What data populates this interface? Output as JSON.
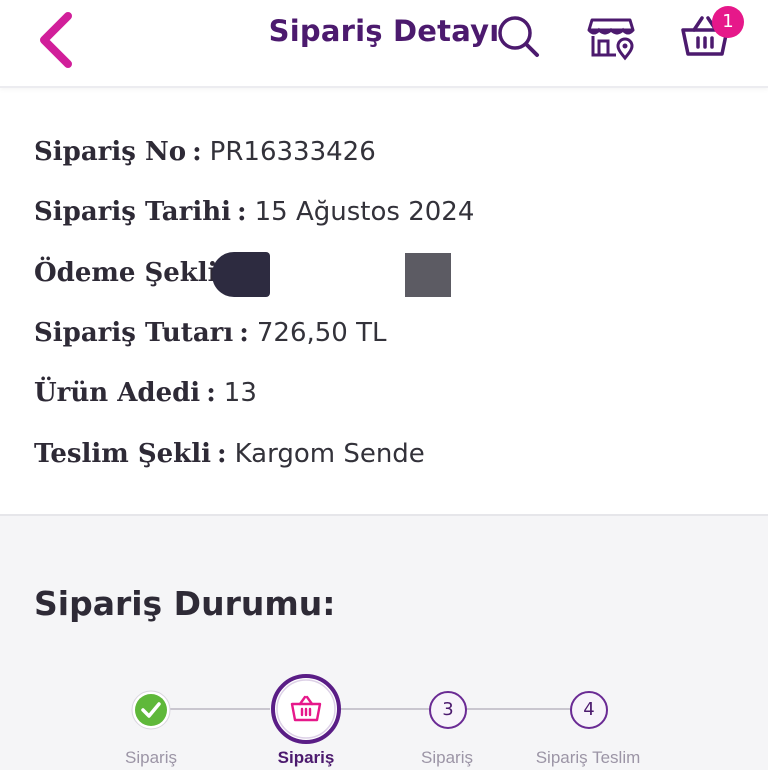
{
  "header": {
    "title": "Sipariş Detayı",
    "cart_count": "1",
    "icons": [
      "chevron-left-icon",
      "search-icon",
      "store-location-icon",
      "basket-icon"
    ],
    "accent": "#e6188a",
    "title_color": "#4c1a6e"
  },
  "order": {
    "no_label": "Sipariş No",
    "no_value": "PR16333426",
    "date_label": "Sipariş Tarihi",
    "date_value": "15 Ağustos 2024",
    "payment_label": "Ödeme Şekli",
    "total_label": "Sipariş Tutarı",
    "total_value": "726,50 TL",
    "count_label": "Ürün Adedi",
    "count_value": "13",
    "delivery_label": "Teslim Şekli",
    "delivery_value": "Kargom Sende",
    "separator": ":"
  },
  "status": {
    "title": "Sipariş Durumu:",
    "steps": [
      {
        "label": "Sipariş",
        "state": "done",
        "icon": "check-icon"
      },
      {
        "label": "Sipariş",
        "state": "active",
        "icon": "basket-icon"
      },
      {
        "label": "Sipariş",
        "state": "pending",
        "number": "3"
      },
      {
        "label": "Sipariş Teslim",
        "state": "pending",
        "number": "4"
      }
    ],
    "done_color": "#5fb83a",
    "active_color": "#5a1d86"
  }
}
